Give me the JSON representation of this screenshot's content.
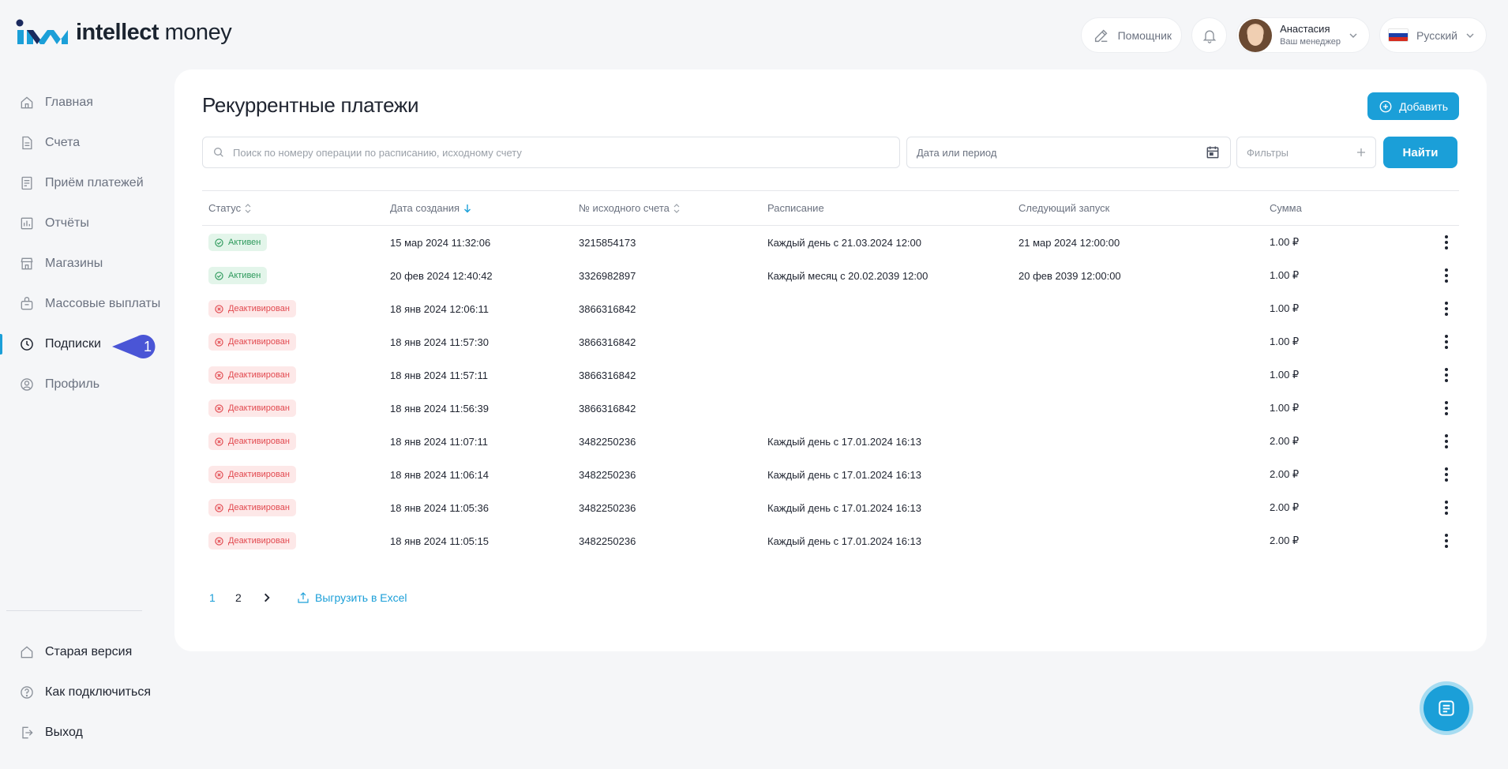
{
  "brand": {
    "name_bold": "intellect",
    "name_light": " money"
  },
  "header": {
    "helper_label": "Помощник",
    "user_name": "Анастасия",
    "user_role": "Ваш менеджер",
    "language": "Русский"
  },
  "sidebar": {
    "items": [
      {
        "label": "Главная",
        "icon": "home-icon"
      },
      {
        "label": "Счета",
        "icon": "document-icon"
      },
      {
        "label": "Приём платежей",
        "icon": "receipt-icon"
      },
      {
        "label": "Отчёты",
        "icon": "chart-icon"
      },
      {
        "label": "Магазины",
        "icon": "store-icon"
      },
      {
        "label": "Массовые выплаты",
        "icon": "bag-icon"
      },
      {
        "label": "Подписки",
        "icon": "clock-icon"
      },
      {
        "label": "Профиль",
        "icon": "user-circle-icon"
      }
    ],
    "bottom": [
      {
        "label": "Старая версия",
        "icon": "home-icon"
      },
      {
        "label": "Как подключиться",
        "icon": "help-icon"
      },
      {
        "label": "Выход",
        "icon": "logout-icon"
      }
    ],
    "marker_number": "1"
  },
  "main": {
    "title": "Рекуррентные платежи",
    "add_label": "Добавить",
    "search_placeholder": "Поиск по номеру операции по расписанию, исходному счету",
    "date_placeholder": "Дата или период",
    "filters_label": "Фильтры",
    "find_label": "Найти"
  },
  "table": {
    "headers": [
      "Статус",
      "Дата создания",
      "№ исходного счета",
      "Расписание",
      "Следующий запуск",
      "Сумма"
    ],
    "rows": [
      {
        "status": "Активен",
        "state": "active",
        "created": "15 мар 2024 11:32:06",
        "account": "3215854173",
        "schedule": "Каждый день с 21.03.2024 12:00",
        "next": "21 мар 2024 12:00:00",
        "sum": "1.00 ₽"
      },
      {
        "status": "Активен",
        "state": "active",
        "created": "20 фев 2024 12:40:42",
        "account": "3326982897",
        "schedule": "Каждый месяц с 20.02.2039 12:00",
        "next": "20 фев 2039 12:00:00",
        "sum": "1.00 ₽"
      },
      {
        "status": "Деактивирован",
        "state": "inactive",
        "created": "18 янв 2024 12:06:11",
        "account": "3866316842",
        "schedule": "",
        "next": "",
        "sum": "1.00 ₽"
      },
      {
        "status": "Деактивирован",
        "state": "inactive",
        "created": "18 янв 2024 11:57:30",
        "account": "3866316842",
        "schedule": "",
        "next": "",
        "sum": "1.00 ₽"
      },
      {
        "status": "Деактивирован",
        "state": "inactive",
        "created": "18 янв 2024 11:57:11",
        "account": "3866316842",
        "schedule": "",
        "next": "",
        "sum": "1.00 ₽"
      },
      {
        "status": "Деактивирован",
        "state": "inactive",
        "created": "18 янв 2024 11:56:39",
        "account": "3866316842",
        "schedule": "",
        "next": "",
        "sum": "1.00 ₽"
      },
      {
        "status": "Деактивирован",
        "state": "inactive",
        "created": "18 янв 2024 11:07:11",
        "account": "3482250236",
        "schedule": "Каждый день с 17.01.2024 16:13",
        "next": "",
        "sum": "2.00 ₽"
      },
      {
        "status": "Деактивирован",
        "state": "inactive",
        "created": "18 янв 2024 11:06:14",
        "account": "3482250236",
        "schedule": "Каждый день с 17.01.2024 16:13",
        "next": "",
        "sum": "2.00 ₽"
      },
      {
        "status": "Деактивирован",
        "state": "inactive",
        "created": "18 янв 2024 11:05:36",
        "account": "3482250236",
        "schedule": "Каждый день с 17.01.2024 16:13",
        "next": "",
        "sum": "2.00 ₽"
      },
      {
        "status": "Деактивирован",
        "state": "inactive",
        "created": "18 янв 2024 11:05:15",
        "account": "3482250236",
        "schedule": "Каждый день с 17.01.2024 16:13",
        "next": "",
        "sum": "2.00 ₽"
      }
    ]
  },
  "pagination": {
    "pages": [
      "1",
      "2"
    ],
    "current": "1",
    "export_label": "Выгрузить в Excel"
  },
  "colors": {
    "accent": "#1b9fd8",
    "active_green": "#2e9a5c",
    "inactive_red": "#e2494f",
    "marker": "#4a55d6"
  }
}
